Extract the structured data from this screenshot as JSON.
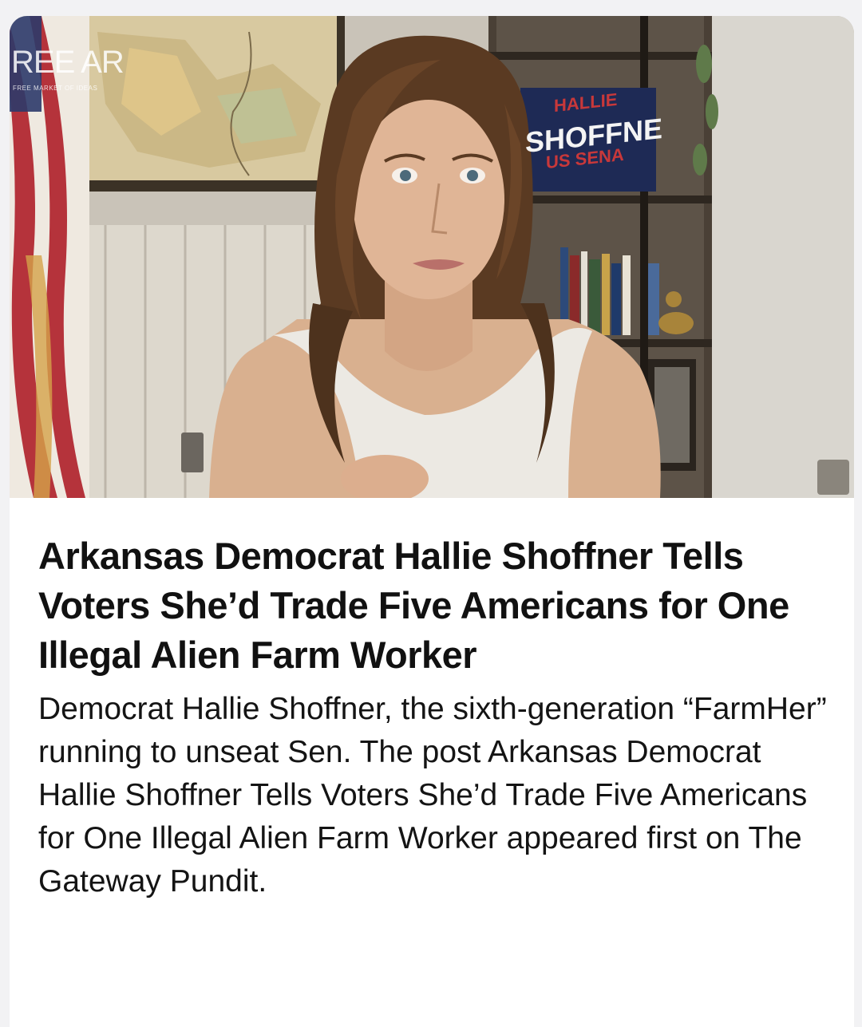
{
  "post": {
    "image": {
      "alt_icon": "video-thumbnail-image",
      "watermark": "REE AR",
      "watermark_sub": "FREE MARKET OF IDEAS",
      "sign_line_1": "HALLIE",
      "sign_line_2": "SHOFFNE",
      "sign_line_3": "US SENA"
    },
    "headline": "Arkansas Democrat Hallie Shoffner Tells Voters She’d Trade Five Americans for One Illegal Alien Farm Worker",
    "excerpt": "Democrat Hallie Shoffner, the sixth-generation “FarmHer” running to unseat Sen. The post Arkansas Democrat Hallie Shoffner Tells Voters She’d Trade Five Americans for One Illegal Alien Farm Worker appeared first on The Gateway Pundit."
  },
  "colors": {
    "page_background": "#f2f2f4",
    "card_background": "#ffffff",
    "text": "#111111",
    "flag_red": "#b5333b",
    "sign_red": "#c8383a"
  }
}
